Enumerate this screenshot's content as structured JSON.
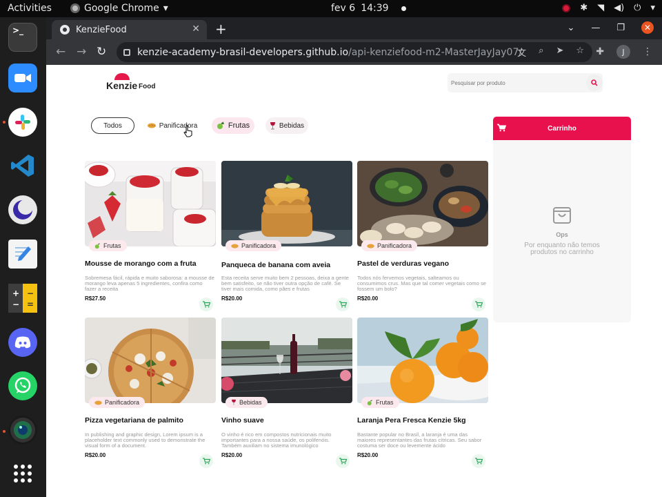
{
  "topbar": {
    "activities": "Activities",
    "app_name": "Google Chrome",
    "date": "fev 6",
    "time": "14:39"
  },
  "browser": {
    "tab_title": "KenzieFood",
    "url_host": "kenzie-academy-brasil-developers.github.io",
    "url_path": "/api-kenziefood-m2-MasterJayJay07/",
    "profile_initial": "J"
  },
  "header": {
    "logo_main": "Kenzie",
    "logo_sub": "Food",
    "search_placeholder": "Pesquisar por produto"
  },
  "filters": [
    {
      "label": "Todos",
      "icon": ""
    },
    {
      "label": "Panificadora",
      "icon": "bread-icon"
    },
    {
      "label": "Frutas",
      "icon": "fruit-icon"
    },
    {
      "label": "Bebidas",
      "icon": "wine-icon"
    }
  ],
  "products": [
    {
      "name": "Mousse de morango com a fruta",
      "category": "Frutas",
      "description": "Sobremesa fácil, rápida e muito saborosa: a mousse de morango leva apenas 5 ingredientes, confira como fazer a receita",
      "price": "R$27.50"
    },
    {
      "name": "Panqueca de banana com aveia",
      "category": "Panificadora",
      "description": "Esta receita serve muito bem 2 pessoas, deixa a gente bem satisfeito, se não tiver outra opção de café. Se tiver mais comida, como pães e frutas",
      "price": "R$20.00"
    },
    {
      "name": "Pastel de verduras vegano",
      "category": "Panificadora",
      "description": "Todos nós fervemos vegetais, salteamos ou consumimos crus. Mas que tal comer vegetais como se fossem um bolo?",
      "price": "R$20.00"
    },
    {
      "name": "Pizza vegetariana de palmito",
      "category": "Panificadora",
      "description": "In publishing and graphic design, Lorem ipsum is a placeholder text commonly used to demonstrate the visual form of a document.",
      "price": "R$20.00"
    },
    {
      "name": "Vinho suave",
      "category": "Bebidas",
      "description": "O vinho é rico em compostos nutricionais muito importantes para a nossa saúde, os polifenóis. Também auxiliam no sistema imunológico",
      "price": "R$20.00"
    },
    {
      "name": "Laranja Pera Fresca Kenzie 5kg",
      "category": "Frutas",
      "description": "Bastante popular no Brasil, a laranja é uma das maiores representantes das frutas cítricas. Seu sabor costuma ser doce ou levemente ácido",
      "price": "R$20.00"
    }
  ],
  "cart": {
    "title": "Carrinho",
    "empty_title": "Ops",
    "empty_message": "Por enquanto não temos produtos no carrinho"
  },
  "colors": {
    "accent": "#e8114e",
    "chrome_dark": "#202124",
    "cart_bg": "#f7f7f7"
  }
}
